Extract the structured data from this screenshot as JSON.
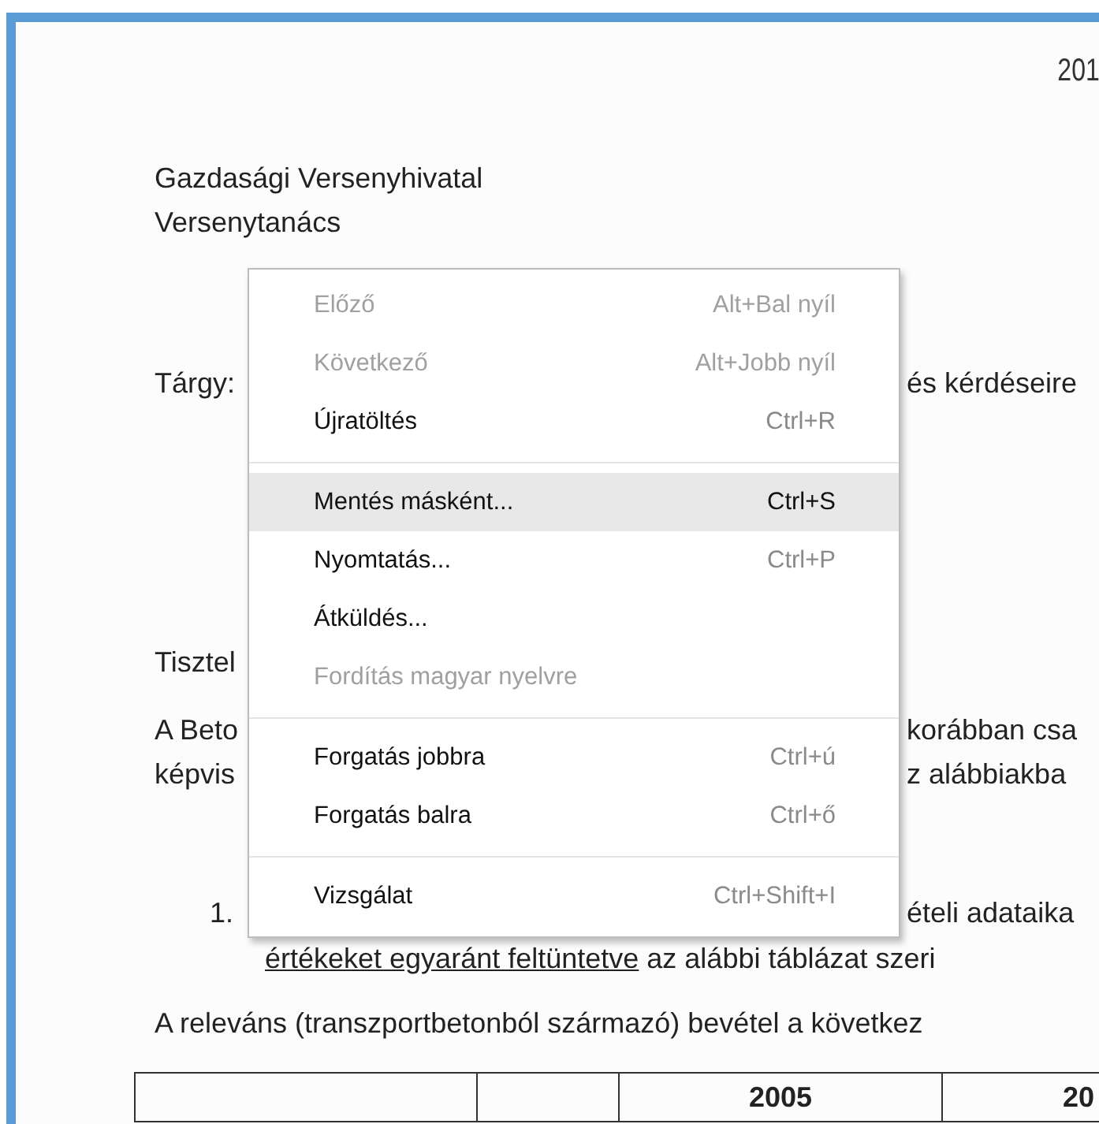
{
  "document": {
    "header_fragment": "201",
    "addressee": [
      "Gazdasági Versenyhivatal",
      "Versenytanács"
    ],
    "subject": {
      "label": "Tárgy:",
      "text_fragment": "és kérdéseire"
    },
    "salutation_fragment": "Tisztel",
    "paragraph": [
      {
        "left": "A Beto",
        "right": "korábban csa"
      },
      {
        "left": "képvis",
        "right": "z alábbiakba"
      }
    ],
    "numbered_item": {
      "number": "1.",
      "fragment": "ételi adataika",
      "continuation_underlined": "értékeket egyaránt feltüntetve",
      "continuation": "az alábbi táblázat szeri"
    },
    "revenue_sentence": "A releváns (transzportbetonból származó) bevétel a következ",
    "table": {
      "year_headers": [
        "2005",
        "20"
      ]
    }
  },
  "menu": {
    "items": [
      {
        "kind": "item",
        "label": "Előző",
        "shortcut": "Alt+Bal nyíl",
        "disabled": true,
        "selected": false
      },
      {
        "kind": "item",
        "label": "Következő",
        "shortcut": "Alt+Jobb nyíl",
        "disabled": true,
        "selected": false
      },
      {
        "kind": "item",
        "label": "Újratöltés",
        "shortcut": "Ctrl+R",
        "disabled": false,
        "selected": false
      },
      {
        "kind": "separator"
      },
      {
        "kind": "item",
        "label": "Mentés másként...",
        "shortcut": "Ctrl+S",
        "disabled": false,
        "selected": true
      },
      {
        "kind": "item",
        "label": "Nyomtatás...",
        "shortcut": "Ctrl+P",
        "disabled": false,
        "selected": false
      },
      {
        "kind": "item",
        "label": "Átküldés...",
        "disabled": false,
        "selected": false
      },
      {
        "kind": "item",
        "label": "Fordítás magyar nyelvre",
        "disabled": true,
        "selected": false
      },
      {
        "kind": "separator"
      },
      {
        "kind": "item",
        "label": "Forgatás jobbra",
        "shortcut": "Ctrl+ú",
        "disabled": false,
        "selected": false
      },
      {
        "kind": "item",
        "label": "Forgatás balra",
        "shortcut": "Ctrl+ő",
        "disabled": false,
        "selected": false
      },
      {
        "kind": "separator"
      },
      {
        "kind": "item",
        "label": "Vizsgálat",
        "shortcut": "Ctrl+Shift+I",
        "disabled": false,
        "selected": false
      }
    ]
  }
}
